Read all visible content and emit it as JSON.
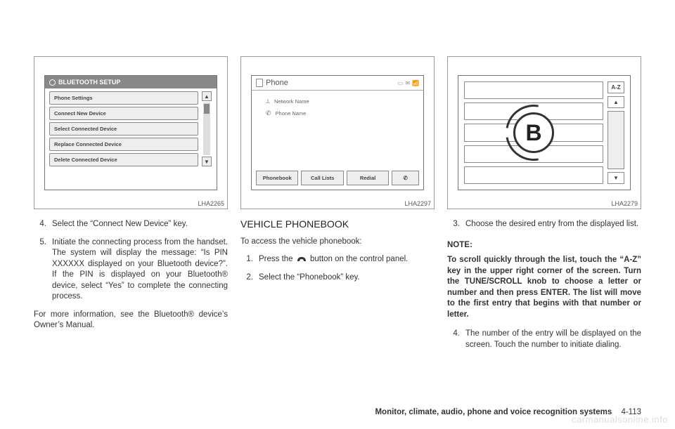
{
  "figures": {
    "fig1": {
      "label": "LHA2265",
      "title": "BLUETOOTH SETUP",
      "rows": [
        "Phone Settings",
        "Connect New Device",
        "Select Connected Device",
        "Replace Connected Device",
        "Delete Connected Device"
      ]
    },
    "fig2": {
      "label": "LHA2297",
      "title": "Phone",
      "info1": "Network Name",
      "info2": "Phone Name",
      "buttons": [
        "Phonebook",
        "Call Lists",
        "Redial"
      ]
    },
    "fig3": {
      "label": "LHA2279",
      "knob": "B",
      "tag": "A-Z"
    }
  },
  "col1": {
    "step4_num": "4.",
    "step4_txt": "Select the “Connect New Device” key.",
    "step5_num": "5.",
    "step5_txt": "Initiate the connecting process from the handset. The system will display the message: “Is PIN XXXXXX displayed on your Bluetooth device?”. If the PIN is displayed on your Bluetooth® device, select “Yes” to complete the connecting process.",
    "para": "For more information, see the Bluetooth® device’s Owner’s Manual."
  },
  "col2": {
    "heading": "VEHICLE PHONEBOOK",
    "intro": "To access the vehicle phonebook:",
    "step1_num": "1.",
    "step1_pre": "Press the",
    "step1_post": "button on the control panel.",
    "step2_num": "2.",
    "step2_txt": "Select the “Phonebook” key."
  },
  "col3": {
    "step3_num": "3.",
    "step3_txt": "Choose the desired entry from the displayed list.",
    "note_label": "NOTE:",
    "note_body": "To scroll quickly through the list, touch the “A-Z” key in the upper right corner of the screen. Turn the TUNE/SCROLL knob to choose a letter or number and then press ENTER. The list will move to the first entry that begins with that number or letter.",
    "step4_num": "4.",
    "step4_txt": "The number of the entry will be displayed on the screen. Touch the number to initiate dialing."
  },
  "footer": {
    "section": "Monitor, climate, audio, phone and voice recognition systems",
    "page": "4-113"
  },
  "watermark": "carmanualsonline.info"
}
